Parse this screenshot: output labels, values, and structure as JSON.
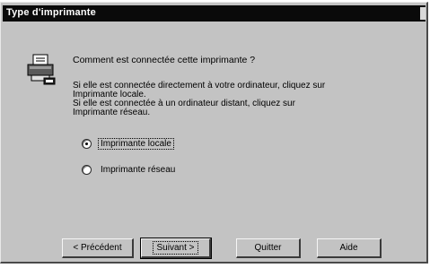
{
  "window": {
    "title": "Type d'imprimante"
  },
  "dialog": {
    "question": "Comment est connectée cette imprimante ?",
    "description": [
      "Si elle est connectée directement à votre ordinateur, cliquez sur",
      "Imprimante locale.",
      "Si elle est connectée à un ordinateur distant, cliquez sur",
      "Imprimante réseau."
    ],
    "options": [
      {
        "label": "Imprimante locale",
        "checked": true
      },
      {
        "label": "Imprimante réseau",
        "checked": false
      }
    ]
  },
  "buttons": {
    "back": "< Précédent",
    "next": "Suivant >",
    "quit": "Quitter",
    "help": "Aide"
  },
  "icons": {
    "printer": "printer-icon"
  }
}
